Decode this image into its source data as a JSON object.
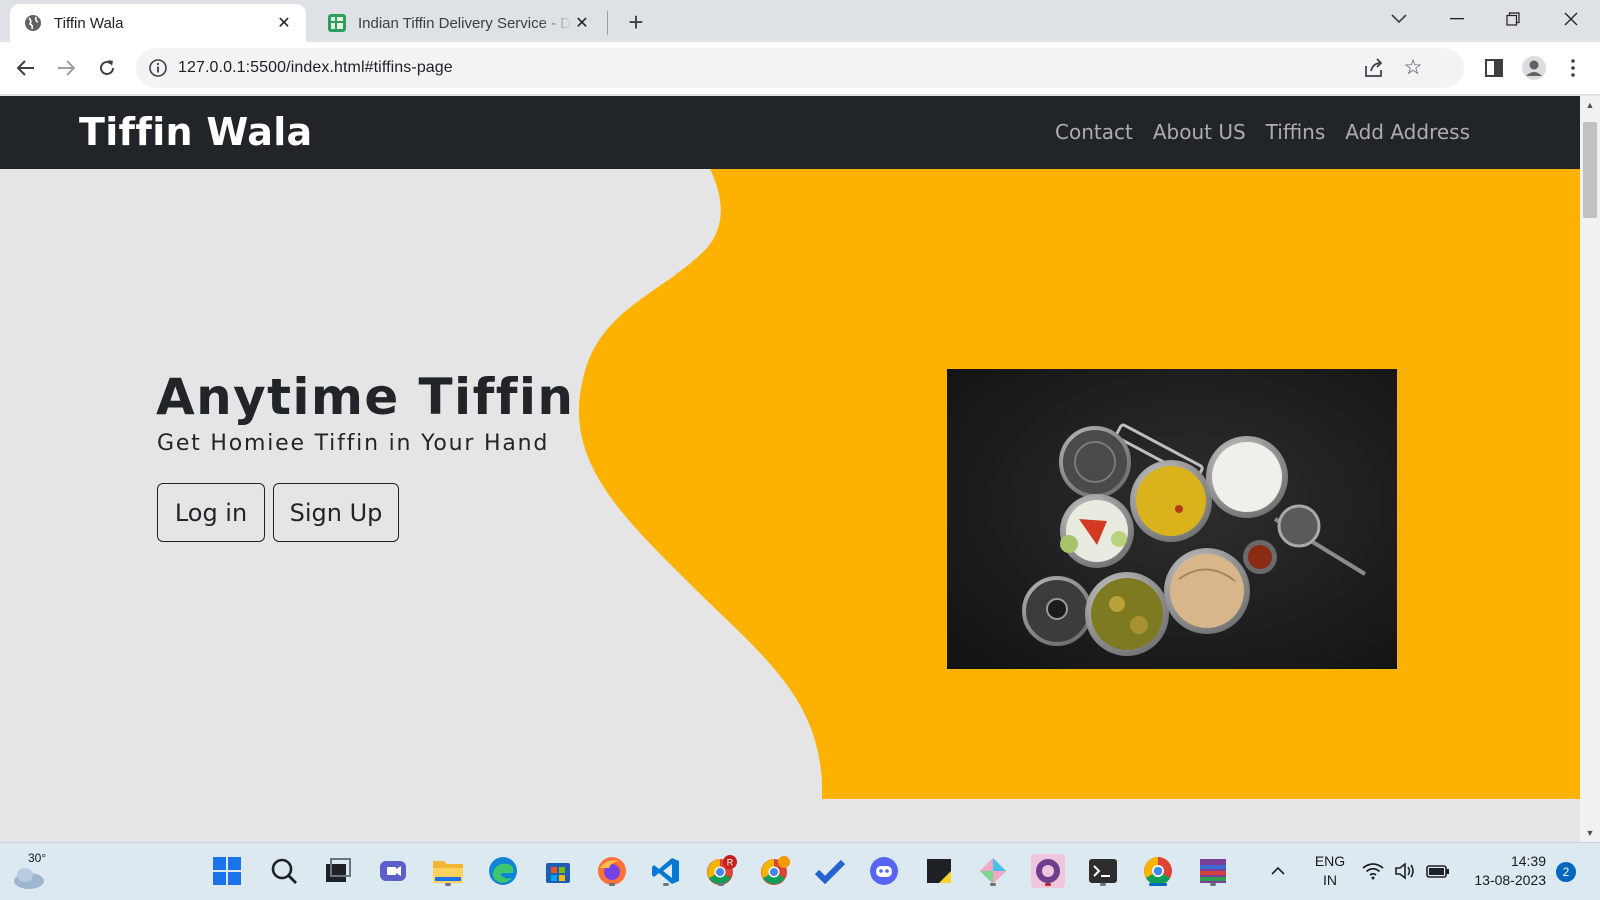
{
  "browser": {
    "tabs": [
      {
        "title": "Tiffin Wala",
        "active": true,
        "favicon": "globe-icon"
      },
      {
        "title": "Indian Tiffin Delivery Service - Da",
        "active": false,
        "favicon": "sheet-icon"
      }
    ],
    "url": "127.0.0.1:5500/index.html#tiffins-page"
  },
  "site": {
    "brand": "Tiffin Wala",
    "nav": [
      "Contact",
      "About US",
      "Tiffins",
      "Add Address"
    ],
    "hero": {
      "title": "Anytime Tiffin",
      "subtitle": "Get Homiee Tiffin in Your Hand",
      "login_label": "Log in",
      "signup_label": "Sign Up"
    },
    "colors": {
      "navbar": "#212529",
      "accent": "#fdb201",
      "background": "#e5e5e5"
    }
  },
  "taskbar": {
    "weather_temp": "30°",
    "language_line1": "ENG",
    "language_line2": "IN",
    "time": "14:39",
    "date": "13-08-2023",
    "notifications": "2"
  }
}
